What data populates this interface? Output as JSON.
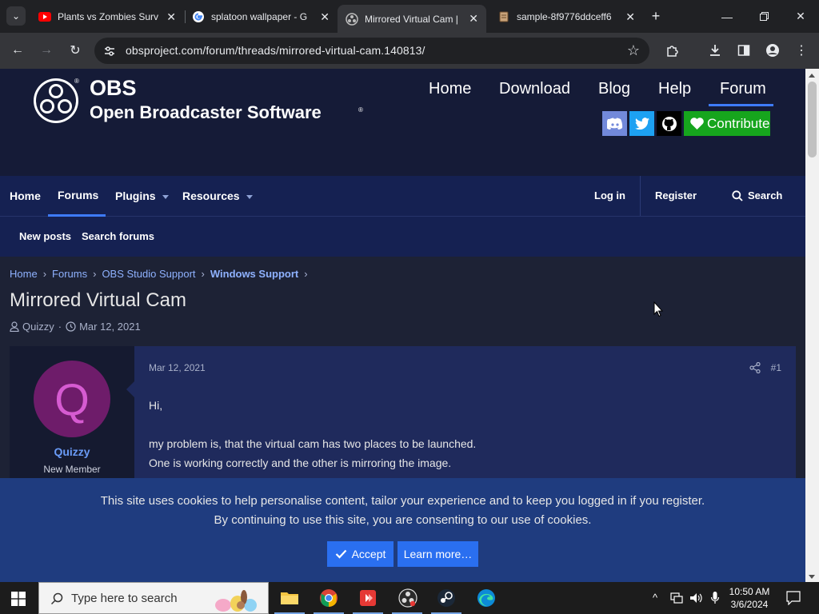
{
  "browser": {
    "tabs": [
      {
        "title": "Plants vs Zombies Surv",
        "favicon": "youtube-icon"
      },
      {
        "title": "splatoon wallpaper - G",
        "favicon": "google-icon"
      },
      {
        "title": "Mirrored Virtual Cam |",
        "favicon": "obs-icon",
        "active": true
      },
      {
        "title": "sample-8f9776ddceff6",
        "favicon": "document-icon"
      }
    ],
    "url": "obsproject.com/forum/threads/mirrored-virtual-cam.140813/"
  },
  "site": {
    "brand_short": "OBS",
    "brand_full": "Open Broadcaster Software",
    "reg_mark": "®",
    "nav": [
      "Home",
      "Download",
      "Blog",
      "Help",
      "Forum"
    ],
    "contribute_label": "Contribute",
    "accent_color": "#3e7bfa",
    "contribute_color": "#16a51d"
  },
  "forum_nav": {
    "items": [
      "Home",
      "Forums",
      "Plugins",
      "Resources"
    ],
    "login": "Log in",
    "register": "Register",
    "search": "Search",
    "sub_items": [
      "New posts",
      "Search forums"
    ]
  },
  "breadcrumbs": [
    "Home",
    "Forums",
    "OBS Studio Support",
    "Windows Support"
  ],
  "thread": {
    "title": "Mirrored Virtual Cam",
    "author": "Quizzy",
    "date": "Mar 12, 2021"
  },
  "post": {
    "avatar_letter": "Q",
    "username": "Quizzy",
    "user_title": "New Member",
    "date": "Mar 12, 2021",
    "number": "#1",
    "lines": [
      "Hi,",
      "",
      "my problem is, that the virtual cam has two places to be launched.",
      "One is working correctly and the other is mirroring the image."
    ]
  },
  "cookie_notice": {
    "line1": "This site uses cookies to help personalise content, tailor your experience and to keep you logged in if you register.",
    "line2": "By continuing to use this site, you are consenting to our use of cookies.",
    "accept": "Accept",
    "learn_more": "Learn more…"
  },
  "taskbar": {
    "search_placeholder": "Type here to search",
    "time": "10:50 AM",
    "date": "3/6/2024"
  }
}
